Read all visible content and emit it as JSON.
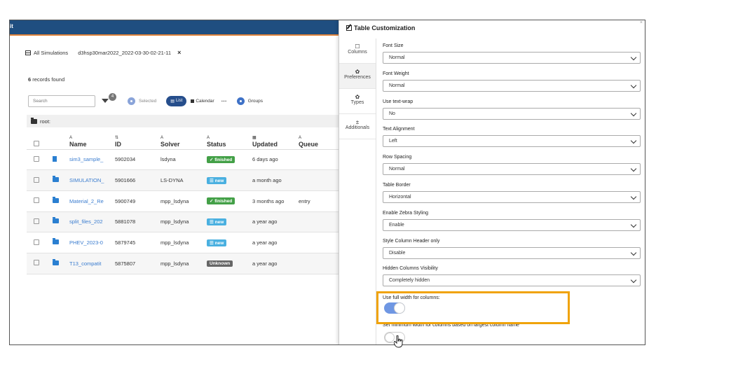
{
  "app": {
    "topbar_text": "it",
    "tabs": [
      {
        "label": "All Simulations"
      },
      {
        "label": "d3hsp30mar2022_2022-03-30-02-21-11"
      }
    ],
    "close_glyph": "×",
    "records_count": "6",
    "records_label": "records found",
    "search_placeholder": "Search",
    "filter_badge": "4",
    "selected_label": "Selected",
    "list_label": "List",
    "calendar_label": "Calendar",
    "more_label": "···",
    "groups_label": "Groups",
    "root_label": "root:",
    "columns": [
      {
        "sort": "A",
        "label": "Name"
      },
      {
        "sort": "⇅",
        "label": "ID"
      },
      {
        "sort": "A",
        "label": "Solver"
      },
      {
        "sort": "A",
        "label": "Status"
      },
      {
        "sort": "▦",
        "label": "Updated"
      },
      {
        "sort": "A",
        "label": "Queue"
      }
    ],
    "rows": [
      {
        "name": "sim3_sample_",
        "id": "5902034",
        "solver": "lsdyna",
        "status": "✓ finished",
        "updated": "6 days ago",
        "queue": ""
      },
      {
        "name": "SIMULATION_",
        "id": "5901666",
        "solver": "LS-DYNA",
        "status": "☰ new",
        "updated": "a month ago",
        "queue": ""
      },
      {
        "name": "Material_2_Re",
        "id": "5900749",
        "solver": "mpp_lsdyna",
        "status": "✓ finished",
        "updated": "3 months ago",
        "queue": "entry"
      },
      {
        "name": "split_files_202",
        "id": "5881078",
        "solver": "mpp_lsdyna",
        "status": "☰ new",
        "updated": "a year ago",
        "queue": ""
      },
      {
        "name": "PHEV_2023-0",
        "id": "5879745",
        "solver": "mpp_lsdyna",
        "status": "☰ new",
        "updated": "a year ago",
        "queue": ""
      },
      {
        "name": "T13_compatit",
        "id": "5875807",
        "solver": "mpp_lsdyna",
        "status": "Unknown",
        "updated": "a year ago",
        "queue": ""
      }
    ]
  },
  "panel": {
    "title": "Table Customization",
    "nav": [
      {
        "icon": "☐",
        "label": "Columns"
      },
      {
        "icon": "✿",
        "label": "Preferences"
      },
      {
        "icon": "✿",
        "label": "Types"
      },
      {
        "icon": "±",
        "label": "Additionals"
      }
    ],
    "fields": [
      {
        "label": "Font Size",
        "value": "Normal"
      },
      {
        "label": "Font Weight",
        "value": "Normal"
      },
      {
        "label": "Use text-wrap",
        "value": "No"
      },
      {
        "label": "Text Alignment",
        "value": "Left"
      },
      {
        "label": "Row Spacing",
        "value": "Normal"
      },
      {
        "label": "Table Border",
        "value": "Horizontal"
      },
      {
        "label": "Enable Zebra Styling",
        "value": "Enable"
      },
      {
        "label": "Style Column Header only",
        "value": "Disable"
      },
      {
        "label": "Hidden Columns Visibility",
        "value": "Completely hidden"
      }
    ],
    "full_width_label": "Use full width for columns:",
    "full_width_on": true,
    "min_width_label": "Set minimum width for columns based on largest column name",
    "min_width_on": false
  },
  "colors": {
    "topbar": "#1f4e80",
    "accent": "#e0833a",
    "link": "#3a7ccf",
    "finished": "#43a047",
    "new": "#4ab0e0",
    "unknown": "#666666",
    "highlight": "#f0a30a",
    "toggle_on": "#6f97e3"
  }
}
